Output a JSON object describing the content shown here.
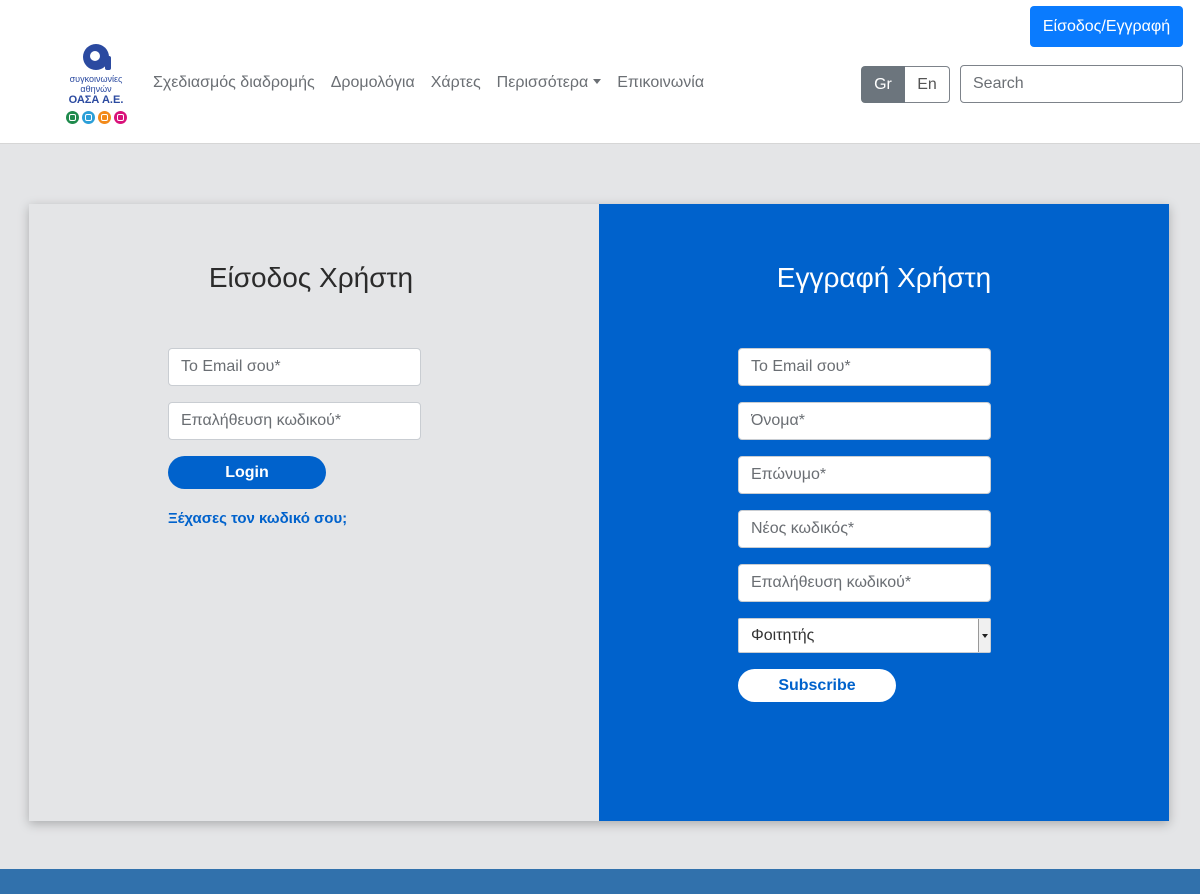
{
  "header": {
    "logo": {
      "line1": "συγκοινωνίες",
      "line2": "αθηνών",
      "line3": "ΟΑΣΑ Α.Ε.",
      "icons": [
        "tram-icon",
        "bus-icon",
        "trolley-icon",
        "metro-icon"
      ],
      "icon_colors": [
        "#1f8a4c",
        "#2b9fd8",
        "#f28a1a",
        "#d9127a"
      ],
      "brand_color": "#2b4aa0"
    },
    "nav": [
      "Σχεδιασμός διαδρομής",
      "Δρομολόγια",
      "Χάρτες",
      "Περισσότερα",
      "Επικοινωνία"
    ],
    "login_register_button": "Είσοδος/Εγγραφή",
    "lang_gr": "Gr",
    "lang_en": "En",
    "search_placeholder": "Search"
  },
  "login": {
    "title": "Είσοδος Χρήστη",
    "email_placeholder": "Το Email σου*",
    "password_placeholder": "Επαλήθευση κωδικού*",
    "button": "Login",
    "forgot": "Ξέχασες τον κωδικό σου;"
  },
  "register": {
    "title": "Εγγραφή Χρήστη",
    "email_placeholder": "Το Email σου*",
    "name_placeholder": "Όνομα*",
    "surname_placeholder": "Επώνυμο*",
    "new_password_placeholder": "Νέος κωδικός*",
    "confirm_password_placeholder": "Επαλήθευση κωδικού*",
    "role_selected": "Φοιτητής",
    "button": "Subscribe"
  },
  "colors": {
    "primary": "#0062cc",
    "top_button": "#0a7bfe",
    "footer": "#3171ac",
    "background": "#e4e5e7"
  }
}
